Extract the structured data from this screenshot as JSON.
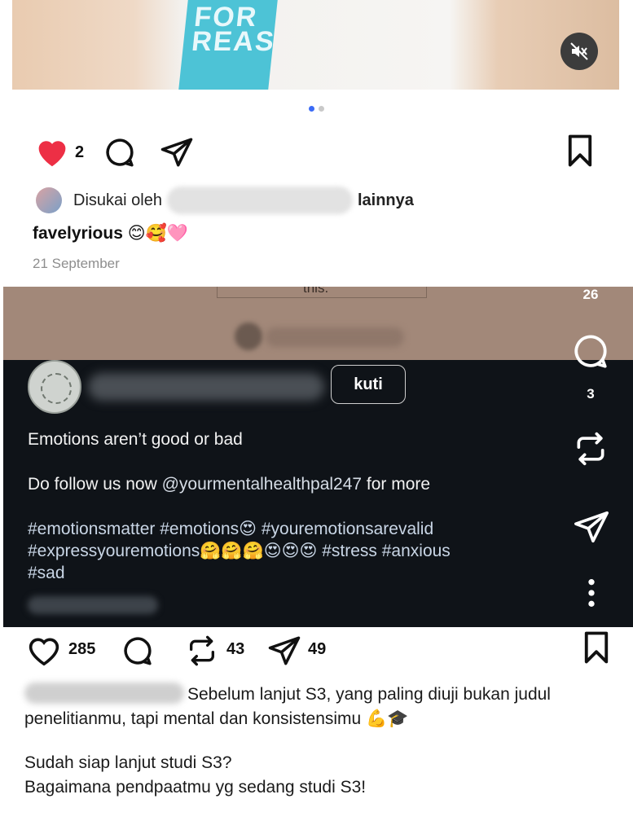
{
  "post1": {
    "photo_print_text": "FOR REAS",
    "likes_count": "2",
    "liked_by_prefix": "Disukai oleh",
    "liked_by_suffix": "lainnya",
    "username": "favelyrious",
    "caption_emojis": "😊🥰🩷",
    "date": "21 September",
    "carousel": {
      "total": 2,
      "active": 1
    },
    "icons": [
      "mute-icon",
      "heart-filled-icon",
      "comment-icon",
      "share-icon",
      "bookmark-icon"
    ]
  },
  "embedded_post": {
    "top_snippet": "this.",
    "follow_label": "kuti",
    "line1": "Emotions aren’t good or bad",
    "line2_prefix": "Do follow us now",
    "line2_mention": "@yourmentalhealthpal247",
    "line2_suffix": "for more",
    "hashtags_line1": "#emotionsmatter #emotions😍 #youremotionsarevalid",
    "hashtags_line2": "#expressyouremotions🤗🤗🤗😍😍😍 #stress #anxious",
    "hashtags_line3": "#sad",
    "rail": {
      "like_count": "26",
      "comment_count": "3"
    },
    "icons": [
      "comment-icon",
      "repost-icon",
      "share-icon",
      "more-icon"
    ]
  },
  "post2": {
    "likes": "285",
    "reposts": "43",
    "shares": "49",
    "caption_line1": "Sebelum lanjut S3, yang paling diuji bukan judul",
    "caption_line2": "penelitianmu, tapi mental dan konsistensimu 💪🎓",
    "caption_line3": "Sudah siap lanjut studi S3?",
    "caption_line4": "Bagaimana pendpaatmu yg sedang studi S3!",
    "icons": [
      "heart-outline-icon",
      "comment-icon",
      "repost-icon",
      "share-icon",
      "bookmark-icon"
    ]
  },
  "colors": {
    "like_red": "#ed2f45",
    "dark_bg": "#0f1318",
    "brown_band": "#a28879",
    "dot_active": "#3b6bf6",
    "muted_gray": "#8e8e8e"
  }
}
